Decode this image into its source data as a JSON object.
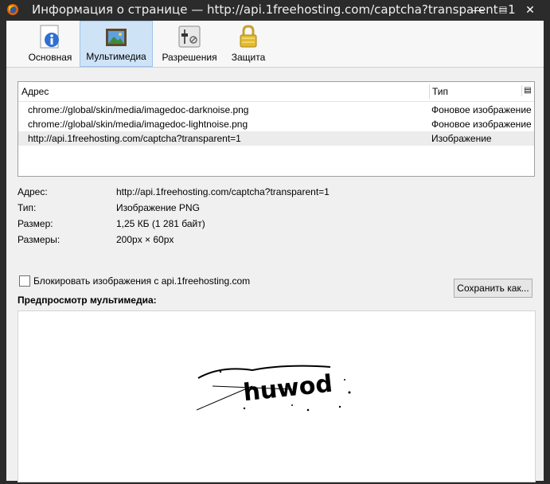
{
  "window": {
    "title": "Информация о странице — http://api.1freehosting.com/captcha?transparent=1",
    "minimize": "—",
    "maximize": "□",
    "close": "✕"
  },
  "tabs": [
    {
      "label": "Основная",
      "icon": "info-icon"
    },
    {
      "label": "Мультимедиа",
      "icon": "media-icon",
      "selected": true
    },
    {
      "label": "Разрешения",
      "icon": "permissions-icon"
    },
    {
      "label": "Защита",
      "icon": "lock-icon"
    }
  ],
  "media_list": {
    "col_address": "Адрес",
    "col_type": "Тип",
    "rows": [
      {
        "address": "chrome://global/skin/media/imagedoc-darknoise.png",
        "type": "Фоновое изображение"
      },
      {
        "address": "chrome://global/skin/media/imagedoc-lightnoise.png",
        "type": "Фоновое изображение"
      },
      {
        "address": "http://api.1freehosting.com/captcha?transparent=1",
        "type": "Изображение",
        "selected": true
      }
    ]
  },
  "properties": [
    {
      "key": "Адрес:",
      "value": "http://api.1freehosting.com/captcha?transparent=1"
    },
    {
      "key": "Тип:",
      "value": "Изображение PNG"
    },
    {
      "key": "Размер:",
      "value": "1,25 КБ (1 281 байт)"
    },
    {
      "key": "Размеры:",
      "value": "200px × 60px"
    }
  ],
  "block_images": {
    "label": "Блокировать изображения с api.1freehosting.com",
    "checked": false
  },
  "save_button": "Сохранить как...",
  "preview_label": "Предпросмотр мультимедиа:",
  "captcha_text": "huwod",
  "colors": {
    "selected_tab": "#cfe3f7",
    "title_bar": "#2b2b2b"
  }
}
